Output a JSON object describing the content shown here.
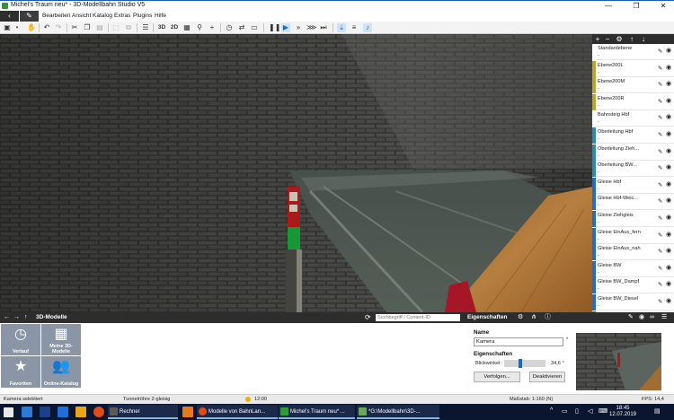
{
  "window": {
    "title": "Michel's Traum neu* - 3D-Modellbahn Studio V5",
    "minimize": "—",
    "maximize": "❐",
    "close": "✕"
  },
  "menubar": {
    "items": [
      "Bearbeiten",
      "Ansicht",
      "Katalog",
      "Extras",
      "Plugins",
      "Hilfe"
    ]
  },
  "toolbar": {
    "view_3d": "3D",
    "view_2d": "2D"
  },
  "layers": [
    {
      "name": "Standardebene",
      "sub": "-",
      "color": "#ffffff"
    },
    {
      "name": "Ebene200L",
      "sub": "-",
      "color": "#b8a92a"
    },
    {
      "name": "Ebene200M",
      "sub": "-",
      "color": "#b8a92a"
    },
    {
      "name": "Ebene200R",
      "sub": "-",
      "color": "#b8a92a"
    },
    {
      "name": "Bahnsteig Hbf",
      "sub": "-",
      "color": "#ffffff"
    },
    {
      "name": "Oberleitung Hbf",
      "sub": "-",
      "color": "#2b8ea8"
    },
    {
      "name": "Oberleitung Zieh...",
      "sub": "-",
      "color": "#2b8ea8"
    },
    {
      "name": "Oberleitung BW...",
      "sub": "-",
      "color": "#2b8ea8"
    },
    {
      "name": "Gleise Hbf",
      "sub": "-",
      "color": "#1f6fc4"
    },
    {
      "name": "Gleise Hbf-Weic...",
      "sub": "-",
      "color": "#1f6fc4"
    },
    {
      "name": "Gleise Ziehgleis",
      "sub": "-",
      "color": "#1f6fc4"
    },
    {
      "name": "Gleise EinAus_fern",
      "sub": "-",
      "color": "#1f6fc4"
    },
    {
      "name": "Gleise EinAus_nah",
      "sub": "-",
      "color": "#1f6fc4"
    },
    {
      "name": "Gleise BW",
      "sub": "-",
      "color": "#1f6fc4"
    },
    {
      "name": "Gleise BW_Dampf",
      "sub": "-",
      "color": "#1f6fc4"
    },
    {
      "name": "Gleise BW_Diesel",
      "sub": "-",
      "color": "#1f6fc4"
    },
    {
      "name": "Gleise BW_Elektro",
      "sub": "-",
      "color": "#1f6fc4"
    }
  ],
  "models_panel": {
    "title": "3D-Modelle",
    "search_placeholder": "Suchbegriff / Content-ID",
    "tiles": [
      {
        "label": "Verlauf",
        "icon": "clock-icon"
      },
      {
        "label": "Meine 3D-Modelle",
        "icon": "grid-icon"
      },
      {
        "label": "Favoriten",
        "icon": "star-icon"
      },
      {
        "label": "Online-Katalog",
        "icon": "people-icon"
      }
    ]
  },
  "properties_panel": {
    "title": "Eigenschaften",
    "name_label": "Name",
    "name_value": "Kamera",
    "section_label": "Eigenschaften",
    "fov_label": "Blickwinkel:",
    "fov_value": "34,6 °",
    "fov_fraction": 0.38,
    "follow_button": "Verfolgen...",
    "deactivate_button": "Deaktivieren"
  },
  "statusbar": {
    "selection": "Kamera selektiert",
    "object": "Tunnelröhre 2-gleisig",
    "time": "12:00",
    "scale": "Maßstab: 1:160 (N)",
    "fps": "FPS: 14,4"
  },
  "taskbar": {
    "apps": [
      {
        "label": "Rechner",
        "color": "#5a5a5a"
      },
      {
        "label": "Modelle von BahnLan...",
        "color": "#e04b1a"
      },
      {
        "label": "Michel's Traum neu* ...",
        "color": "#2f9b3a"
      },
      {
        "label": "*G:\\Modellbahn\\3D-...",
        "color": "#6aa84f"
      }
    ],
    "clock_time": "18:45",
    "clock_date": "12.07.2019"
  },
  "colors": {
    "dark_header": "#2d2d2d",
    "accent": "#1769c2",
    "tile": "#8a96a6"
  }
}
